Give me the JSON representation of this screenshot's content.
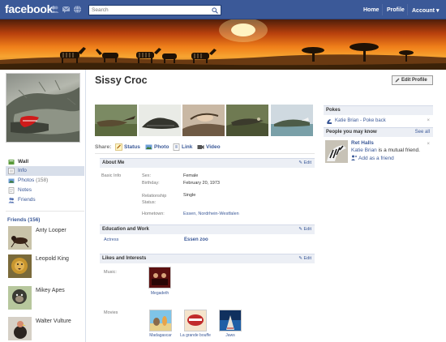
{
  "topbar": {
    "logo": "facebook",
    "search_placeholder": "Search",
    "nav": [
      "Home",
      "Profile",
      "Account ▾"
    ]
  },
  "profile": {
    "name": "Sissy Croc",
    "edit_profile": "Edit Profile"
  },
  "left_nav": [
    {
      "label": "Wall",
      "icon": "wall-icon"
    },
    {
      "label": "Info",
      "icon": "info-icon"
    },
    {
      "label": "Photos",
      "count": "(158)",
      "icon": "photos-icon"
    },
    {
      "label": "Notes",
      "icon": "notes-icon"
    },
    {
      "label": "Friends",
      "icon": "friends-icon"
    }
  ],
  "friends": {
    "title": "Friends",
    "count": "(156)",
    "list": [
      "Anty Looper",
      "Leopold King",
      "Mikey Apes",
      "Walter Vulture"
    ]
  },
  "share": {
    "label": "Share:",
    "options": [
      "Status",
      "Photo",
      "Link",
      "Video"
    ]
  },
  "about": {
    "title": "About Me",
    "edit": "Edit",
    "basic_info_label": "Basic Info",
    "fields": [
      {
        "label": "Sex:",
        "value": "Female"
      },
      {
        "label": "Birthday:",
        "value": "February 20, 1973"
      },
      {
        "label": "Relationship Status:",
        "value": "Single"
      },
      {
        "label": "Hometown:",
        "value": "Essen, Nordrhein-Westfalen"
      }
    ]
  },
  "education": {
    "title": "Education and Work",
    "edit": "Edit",
    "label": "Actress",
    "value": "Essen zoo"
  },
  "likes": {
    "title": "Likes and Interests",
    "edit": "Edit",
    "music_label": "Music:",
    "music": [
      "Megadeth"
    ],
    "movies_label": "Movies",
    "movies": [
      "Madagascar",
      "La grande bouffe",
      "Jaws"
    ]
  },
  "right": {
    "pokes_title": "Pokes",
    "poke_text": "Katie Brian - Poke back",
    "close": "×",
    "pymk_title": "People you may know",
    "see_all": "See all",
    "suggestion_name": "Ret Halls",
    "mutual_name": "Katie Brian",
    "mutual_rest": " is a mutual friend.",
    "add_friend": "Add as a friend"
  },
  "colors": {
    "brand_blue": "#3b5998",
    "section_bg": "#eceff5",
    "nav_active": "#d8dfea"
  }
}
